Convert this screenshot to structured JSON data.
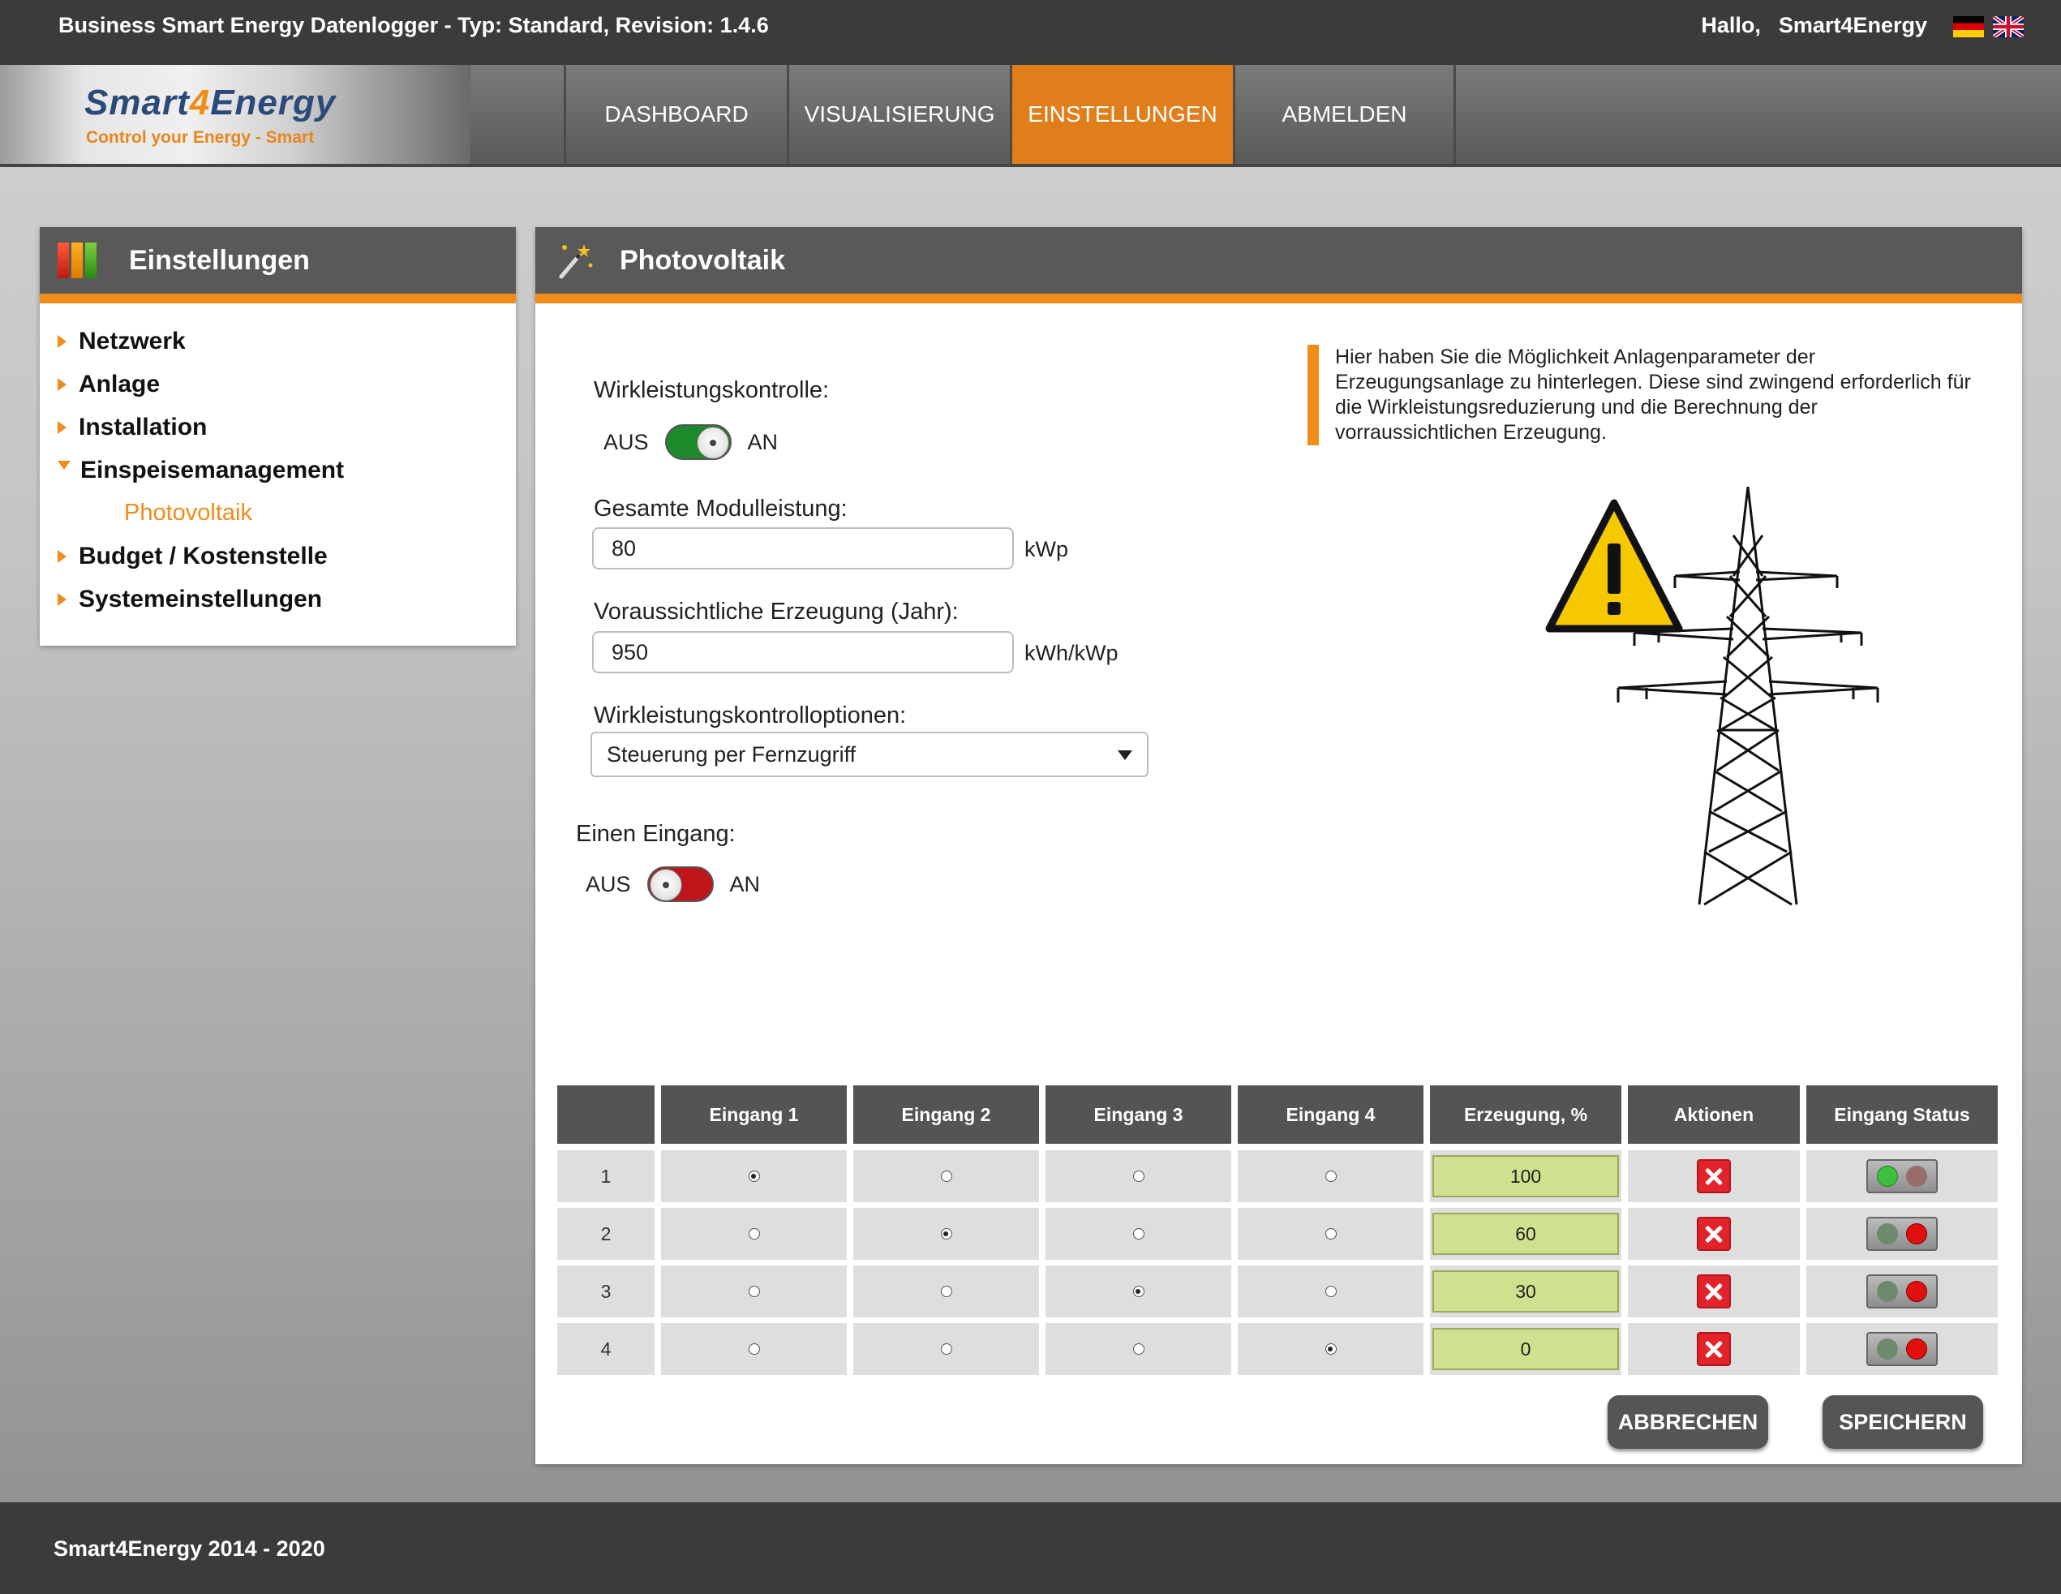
{
  "topbar": {
    "title": "Business Smart Energy Datenlogger - Typ: Standard, Revision: 1.4.6",
    "greeting": "Hallo,",
    "username": "Smart4Energy",
    "languages": [
      "de-flag-icon",
      "gb-flag-icon"
    ]
  },
  "logo": {
    "brand_a": "Smart",
    "brand_four": "4",
    "brand_b": "Energy",
    "tagline": "Control your Energy - Smart"
  },
  "nav": {
    "items": [
      {
        "label": "Dashboard",
        "active": false
      },
      {
        "label": "Visualisierung",
        "active": false
      },
      {
        "label": "Einstellungen",
        "active": true
      },
      {
        "label": "Abmelden",
        "active": false
      }
    ]
  },
  "sidebar": {
    "title": "Einstellungen",
    "items": [
      {
        "label": "Netzwerk"
      },
      {
        "label": "Anlage"
      },
      {
        "label": "Installation"
      },
      {
        "label": "Einspeisemanagement",
        "expanded": true
      },
      {
        "label": "Budget / Kostenstelle"
      },
      {
        "label": "Systemeinstellungen"
      }
    ],
    "sub_item": "Photovoltaik"
  },
  "main": {
    "title": "Photovoltaik",
    "wirk_label": "Wirkleistungskontrolle:",
    "off_label": "AUS",
    "on_label": "AN",
    "wirk_toggle": "on",
    "modul_label": "Gesamte Modulleistung:",
    "modul_value": "80",
    "modul_unit": "kWp",
    "erz_label": "Voraussichtliche Erzeugung (Jahr):",
    "erz_value": "950",
    "erz_unit": "kWh/kWp",
    "optionen_label": "Wirkleistungskontrolloptionen:",
    "optionen_value": "Steuerung per Fernzugriff",
    "info_text": "Hier haben Sie die Möglichkeit Anlagenparameter der Erzeugungsanlage zu hinterlegen. Diese sind zwingend erforderlich für die Wirkleistungsreduzierung und die Berechnung der vorraussichtlichen Erzeugung.",
    "eingang_label": "Einen Eingang:",
    "eingang_toggle": "off",
    "table": {
      "headers": [
        "",
        "Eingang 1",
        "Eingang 2",
        "Eingang 3",
        "Eingang 4",
        "Erzeugung, %",
        "Aktionen",
        "Eingang Status"
      ],
      "rows": [
        {
          "num": "1",
          "selected": 1,
          "value": "100",
          "status": "green"
        },
        {
          "num": "2",
          "selected": 2,
          "value": "60",
          "status": "red"
        },
        {
          "num": "3",
          "selected": 3,
          "value": "30",
          "status": "red"
        },
        {
          "num": "4",
          "selected": 4,
          "value": "0",
          "status": "red"
        }
      ]
    },
    "cancel_label": "Abbrechen",
    "save_label": "Speichern"
  },
  "footer": {
    "text": "Smart4Energy 2014 - 2020"
  },
  "colors": {
    "accent": "#f08c1a",
    "header": "#3b3b3b",
    "toggle_on": "#1c8a2a",
    "toggle_off": "#c0161a"
  }
}
